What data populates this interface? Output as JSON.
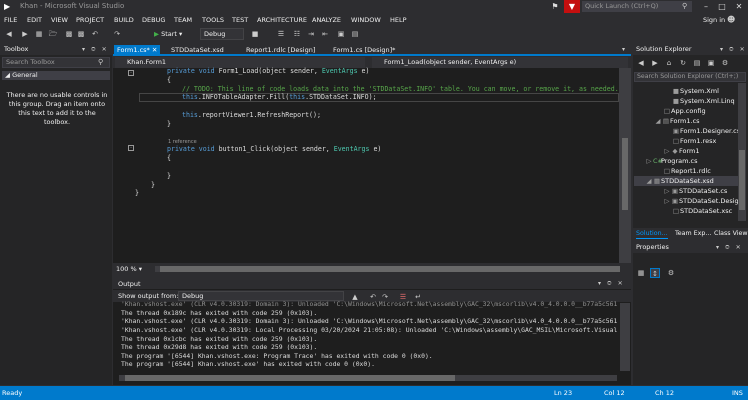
{
  "window": {
    "title": "Khan - Microsoft Visual Studio",
    "quick_launch_placeholder": "Quick Launch (Ctrl+Q)",
    "sign_in": "Sign in"
  },
  "menu": [
    "FILE",
    "EDIT",
    "VIEW",
    "PROJECT",
    "BUILD",
    "DEBUG",
    "TEAM",
    "TOOLS",
    "TEST",
    "ARCHITECTURE",
    "ANALYZE",
    "WINDOW",
    "HELP"
  ],
  "toolbar": {
    "start_label": "Start",
    "configuration": "Debug"
  },
  "toolbox": {
    "title": "Toolbox",
    "search_placeholder": "Search Toolbox",
    "group": "General",
    "empty_message": "There are no usable controls in this group. Drag an item onto this text to add it to the toolbox."
  },
  "tabs": [
    {
      "label": "Form1.cs*",
      "active": true
    },
    {
      "label": "STDDataSet.xsd",
      "active": false
    },
    {
      "label": "Report1.rdlc [Design]",
      "active": false
    },
    {
      "label": "Form1.cs [Design]*",
      "active": false
    }
  ],
  "navigation": {
    "class_selector": "Khan.Form1",
    "member_selector": "Form1_Load(object sender, EventArgs e)"
  },
  "code": {
    "line1_kw": "private void",
    "line1_rest": " Form1_Load(object sender, ",
    "line1_type": "EventArgs",
    "line1_end": " e)",
    "line2": "{",
    "line3": "// TODO: This line of code loads data into the 'STDDataSet.INFO' table. You can move, or remove it, as needed.",
    "line4_kw": "this",
    "line4_rest": ".INFOTableAdapter.Fill(",
    "line4_kw2": "this",
    "line4_end": ".STDDataSet.INFO);",
    "line5_kw": "this",
    "line5_rest": ".reportViewer1.RefreshReport();",
    "line6": "}",
    "references": "1 reference",
    "line7_kw": "private void",
    "line7_rest": " button1_Click(object sender, ",
    "line7_type": "EventArgs",
    "line7_end": " e)",
    "line8": "{",
    "line9": "}",
    "line10": "}",
    "line11": "}"
  },
  "editor": {
    "zoom": "100 %"
  },
  "output": {
    "title": "Output",
    "show_output_from_label": "Show output from:",
    "show_output_from_value": "Debug",
    "lines": [
      "'Khan.vshost.exe' (CLR v4.0.30319: Domain 3): Unloaded 'C:\\Windows\\Microsoft.Net\\assembly\\GAC_32\\mscorlib\\v4.0_4.0.0.0__b77a5c561",
      "The thread 0x189c has exited with code 259 (0x103).",
      "'Khan.vshost.exe' (CLR v4.0.30319: Domain 3): Unloaded 'C:\\Windows\\Microsoft.Net\\assembly\\GAC_32\\mscorlib\\v4.0_4.0.0.0__b77a5c561",
      "'Khan.vshost.exe' (CLR v4.0.30319: Local Processing 03/20/2024 21:05:08): Unloaded 'C:\\Windows\\assembly\\GAC_MSIL\\Microsoft.Visual",
      "The thread 0x1cbc has exited with code 259 (0x103).",
      "The thread 0x29d8 has exited with code 259 (0x103).",
      "The program '[6544] Khan.vshost.exe: Program Trace' has exited with code 0 (0x0).",
      "The program '[6544] Khan.vshost.exe' has exited with code 0 (0x0)."
    ]
  },
  "solution_explorer": {
    "title": "Solution Explorer",
    "search_placeholder": "Search Solution Explorer (Ctrl+;)",
    "items": [
      {
        "label": "System.Xml",
        "icon": "reference-icon"
      },
      {
        "label": "System.Xml.Linq",
        "icon": "reference-icon"
      },
      {
        "label": "App.config",
        "icon": "config-file-icon"
      },
      {
        "label": "Form1.cs",
        "icon": "form-icon"
      },
      {
        "label": "Form1.Designer.cs",
        "icon": "csharp-file-icon"
      },
      {
        "label": "Form1.resx",
        "icon": "resource-file-icon"
      },
      {
        "label": "Form1",
        "icon": "class-icon"
      },
      {
        "label": "Program.cs",
        "icon": "csharp-file-icon"
      },
      {
        "label": "Report1.rdlc",
        "icon": "report-file-icon"
      },
      {
        "label": "STDDataSet.xsd",
        "icon": "dataset-icon"
      },
      {
        "label": "STDDataSet.cs",
        "icon": "csharp-file-icon"
      },
      {
        "label": "STDDataSet.Design",
        "icon": "csharp-file-icon"
      },
      {
        "label": "STDDataSet.xsc",
        "icon": "xsc-file-icon"
      }
    ],
    "tabs": [
      "Solution...",
      "Team Exp...",
      "Class View"
    ]
  },
  "properties": {
    "title": "Properties"
  },
  "status": {
    "state": "Ready",
    "line": "Ln 23",
    "column": "Col 12",
    "char": "Ch 12",
    "mode": "INS"
  },
  "colors": {
    "accent": "#007acc",
    "background": "#2d2d30",
    "editor_background": "#1e1e1e",
    "keyword": "#569cd6",
    "type": "#4ec9b0",
    "comment": "#57a64a",
    "notification_flag": "#c40f0f"
  }
}
